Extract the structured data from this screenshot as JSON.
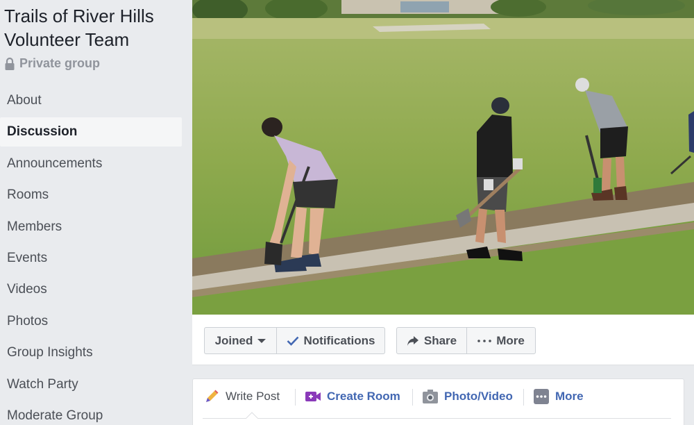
{
  "group": {
    "name": "Trails of River Hills Volunteer Team",
    "privacy": "Private group"
  },
  "sidebar": {
    "items": [
      {
        "label": "About"
      },
      {
        "label": "Discussion",
        "active": true
      },
      {
        "label": "Announcements"
      },
      {
        "label": "Rooms"
      },
      {
        "label": "Members"
      },
      {
        "label": "Events"
      },
      {
        "label": "Videos"
      },
      {
        "label": "Photos"
      },
      {
        "label": "Group Insights"
      },
      {
        "label": "Watch Party"
      },
      {
        "label": "Moderate Group"
      }
    ]
  },
  "actions": {
    "joined": "Joined",
    "notifications": "Notifications",
    "share": "Share",
    "more": "More"
  },
  "composer": {
    "write_post": "Write Post",
    "create_room": "Create Room",
    "photo_video": "Photo/Video",
    "more": "More"
  },
  "colors": {
    "link_blue": "#4267b2",
    "sidebar_bg": "#e9ebee",
    "text_dark": "#1d2129",
    "text_grey": "#4b4f56",
    "room_purple": "#8a3ab9"
  },
  "icons": [
    "lock-icon",
    "caret-down-icon",
    "checkmark-icon",
    "share-arrow-icon",
    "more-dots-icon",
    "pencil-icon",
    "video-room-icon",
    "camera-icon",
    "more-square-icon"
  ]
}
